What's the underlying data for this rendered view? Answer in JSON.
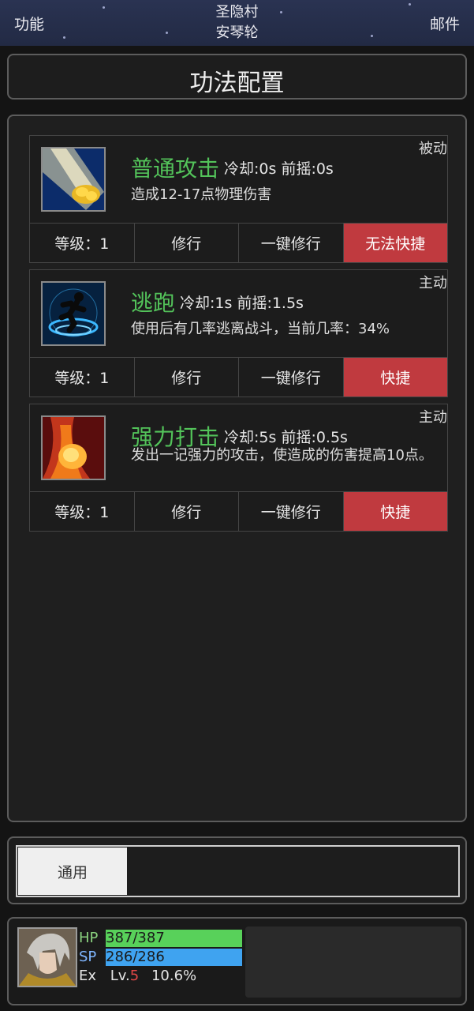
{
  "header": {
    "left_button": "功能",
    "location_line1": "圣隐村",
    "location_line2": "安琴轮",
    "right_button": "邮件"
  },
  "page_title": "功法配置",
  "skills": [
    {
      "name": "普通攻击",
      "cooldown": "冷却:0s 前摇:0s",
      "type": "被动",
      "description": "造成12-17点物理伤害",
      "level": "等级：1",
      "train": "修行",
      "train_all": "一键修行",
      "shortcut": "无法快捷",
      "icon": "golden-fist-icon"
    },
    {
      "name": "逃跑",
      "cooldown": "冷却:1s 前摇:1.5s",
      "type": "主动",
      "description": "使用后有几率逃离战斗，当前几率：34%",
      "level": "等级：1",
      "train": "修行",
      "train_all": "一键修行",
      "shortcut": "快捷",
      "icon": "running-man-icon"
    },
    {
      "name": "强力打击",
      "cooldown": "冷却:5s 前摇:0.5s",
      "type": "主动",
      "description": "发出一记强力的攻击，使造成的伤害提高10点。",
      "level": "等级：1",
      "train": "修行",
      "train_all": "一键修行",
      "shortcut": "快捷",
      "icon": "flaming-fist-icon"
    }
  ],
  "filter": {
    "tab": "通用"
  },
  "status": {
    "hp_label": "HP",
    "hp_value": "387/387",
    "hp_fraction": 1.0,
    "sp_label": "SP",
    "sp_value": "286/286",
    "sp_fraction": 1.0,
    "ex_label": "Ex",
    "lv_prefix": "Lv.",
    "level": "5",
    "exp_percent": "10.6%"
  },
  "colors": {
    "accent_green": "#53c35a",
    "shortcut_red": "#c03a3f",
    "hp_bar": "#58d15a",
    "sp_bar": "#3fa3f0"
  }
}
